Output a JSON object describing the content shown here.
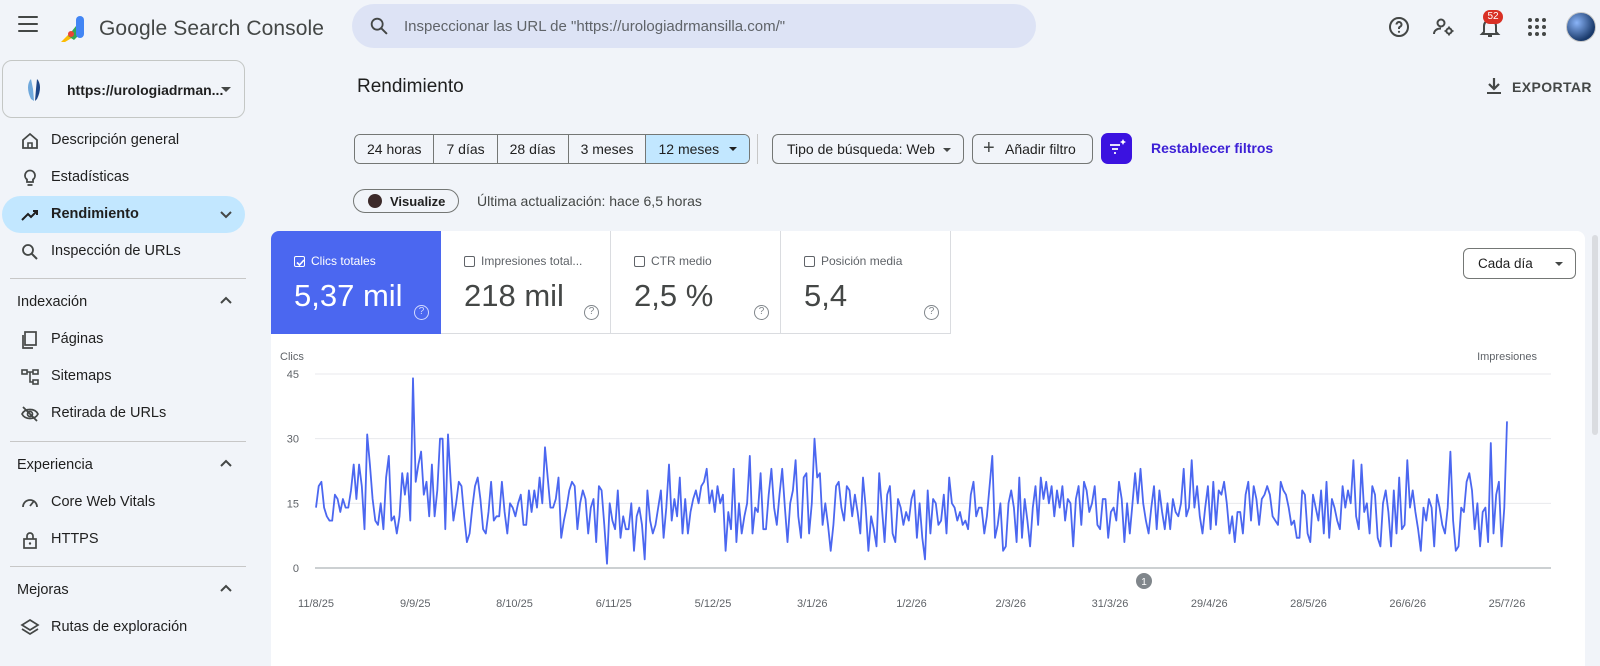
{
  "app": {
    "title": "Google Search Console"
  },
  "search": {
    "placeholder": "Inspeccionar las URL de \"https://urologiadrmansilla.com/\""
  },
  "notifications": {
    "count": "52"
  },
  "property": {
    "url": "https://urologiadrman..."
  },
  "sidebar": {
    "top_items": [
      {
        "label": "Descripción general",
        "icon": "home-icon"
      },
      {
        "label": "Estadísticas",
        "icon": "lightbulb-icon"
      },
      {
        "label": "Rendimiento",
        "icon": "trending-up-icon",
        "active": true
      },
      {
        "label": "Inspección de URLs",
        "icon": "search-icon"
      }
    ],
    "indexacion": {
      "title": "Indexación",
      "items": [
        {
          "label": "Páginas",
          "icon": "pages-icon"
        },
        {
          "label": "Sitemaps",
          "icon": "sitemap-icon"
        },
        {
          "label": "Retirada de URLs",
          "icon": "visibility-off-icon"
        }
      ]
    },
    "experiencia": {
      "title": "Experiencia",
      "items": [
        {
          "label": "Core Web Vitals",
          "icon": "speed-icon"
        },
        {
          "label": "HTTPS",
          "icon": "lock-icon"
        }
      ]
    },
    "mejoras": {
      "title": "Mejoras",
      "items": [
        {
          "label": "Rutas de exploración",
          "icon": "layers-icon"
        }
      ]
    }
  },
  "main": {
    "title": "Rendimiento",
    "export_label": "EXPORTAR",
    "ranges": [
      "24 horas",
      "7 días",
      "28 días",
      "3 meses",
      "12 meses"
    ],
    "selected_range": "12 meses",
    "search_type": "Tipo de búsqueda: Web",
    "add_filter": "Añadir filtro",
    "reset_filters": "Restablecer filtros",
    "visualize": "Visualize",
    "last_update": "Última actualización: hace 6,5 horas",
    "granularity": "Cada día"
  },
  "metrics": [
    {
      "label": "Clics totales",
      "value": "5,37 mil",
      "checked": true,
      "color": "#4b67f0"
    },
    {
      "label": "Impresiones total...",
      "value": "218 mil",
      "checked": false
    },
    {
      "label": "CTR medio",
      "value": "2,5 %",
      "checked": false
    },
    {
      "label": "Posición media",
      "value": "5,4",
      "checked": false
    }
  ],
  "chart_data": {
    "type": "line",
    "ylabel_left": "Clics",
    "ylabel_right": "Impresiones",
    "ylim": [
      0,
      45
    ],
    "yticks": [
      0,
      15,
      30,
      45
    ],
    "xtick_labels": [
      "11/8/25",
      "9/9/25",
      "8/10/25",
      "6/11/25",
      "5/12/25",
      "3/1/26",
      "1/2/26",
      "2/3/26",
      "31/3/26",
      "29/4/26",
      "28/5/26",
      "26/6/26",
      "25/7/26"
    ],
    "annotation": "1",
    "series": [
      {
        "color": "#4b67f0",
        "values": [
          14,
          19,
          20,
          14,
          12,
          11,
          11,
          17,
          16,
          13,
          16,
          14,
          14,
          18,
          24,
          16,
          24,
          19,
          9,
          31,
          24,
          16,
          11,
          10,
          15,
          9,
          21,
          26,
          11,
          12,
          8,
          12,
          22,
          17,
          22,
          11,
          44,
          20,
          24,
          27,
          17,
          20,
          12,
          24,
          12,
          18,
          30,
          30,
          9,
          31,
          20,
          11,
          15,
          20,
          19,
          12,
          6,
          8,
          14,
          19,
          21,
          16,
          9,
          8,
          13,
          20,
          11,
          12,
          12,
          20,
          13,
          8,
          15,
          14,
          12,
          15,
          17,
          10,
          10,
          18,
          13,
          18,
          14,
          21,
          15,
          28,
          21,
          14,
          14,
          16,
          21,
          7,
          11,
          14,
          18,
          20,
          19,
          9,
          15,
          18,
          16,
          8,
          14,
          16,
          6,
          19,
          18,
          10,
          1,
          15,
          11,
          9,
          18,
          7,
          12,
          9,
          9,
          15,
          4,
          12,
          14,
          10,
          2,
          18,
          11,
          8,
          10,
          14,
          18,
          7,
          14,
          24,
          11,
          16,
          12,
          21,
          8,
          16,
          8,
          13,
          16,
          18,
          15,
          19,
          20,
          23,
          15,
          18,
          13,
          19,
          15,
          17,
          4,
          13,
          9,
          23,
          6,
          15,
          8,
          12,
          15,
          26,
          8,
          14,
          13,
          22,
          9,
          9,
          17,
          23,
          14,
          10,
          17,
          23,
          14,
          6,
          15,
          18,
          25,
          12,
          7,
          21,
          22,
          8,
          15,
          30,
          21,
          22,
          10,
          15,
          10,
          4,
          10,
          19,
          20,
          14,
          11,
          19,
          18,
          12,
          17,
          13,
          8,
          21,
          14,
          4,
          12,
          9,
          5,
          22,
          14,
          6,
          17,
          19,
          8,
          6,
          16,
          14,
          10,
          13,
          11,
          16,
          18,
          7,
          15,
          7,
          2,
          18,
          8,
          16,
          15,
          10,
          11,
          17,
          8,
          21,
          15,
          14,
          11,
          13,
          10,
          11,
          9,
          17,
          20,
          12,
          14,
          14,
          8,
          12,
          19,
          26,
          7,
          10,
          15,
          4,
          5,
          15,
          18,
          14,
          6,
          21,
          7,
          16,
          11,
          5,
          14,
          19,
          10,
          21,
          16,
          20,
          15,
          19,
          12,
          18,
          14,
          19,
          11,
          16,
          15,
          5,
          16,
          19,
          10,
          20,
          18,
          13,
          15,
          19,
          10,
          9,
          16,
          16,
          7,
          13,
          14,
          11,
          20,
          16,
          6,
          15,
          8,
          15,
          22,
          15,
          23,
          15,
          11,
          8,
          14,
          19,
          9,
          18,
          13,
          9,
          15,
          9,
          16,
          13,
          12,
          15,
          23,
          12,
          14,
          25,
          14,
          19,
          12,
          8,
          14,
          19,
          9,
          20,
          10,
          18,
          17,
          20,
          15,
          8,
          12,
          6,
          13,
          13,
          8,
          17,
          20,
          11,
          19,
          16,
          10,
          16,
          17,
          19,
          17,
          12,
          11,
          10,
          20,
          18,
          17,
          14,
          10,
          11,
          7,
          7,
          18,
          17,
          8,
          6,
          17,
          14,
          11,
          18,
          8,
          20,
          7,
          16,
          14,
          11,
          9,
          19,
          14,
          18,
          15,
          25,
          12,
          9,
          24,
          13,
          15,
          8,
          19,
          17,
          7,
          5,
          15,
          18,
          13,
          5,
          18,
          8,
          21,
          9,
          10,
          25,
          14,
          18,
          13,
          9,
          4,
          14,
          11,
          16,
          14,
          5,
          17,
          14,
          10,
          8,
          14,
          27,
          11,
          4,
          5,
          14,
          13,
          20,
          22,
          18,
          9,
          15,
          5,
          13,
          14,
          6,
          29,
          8,
          17,
          20,
          5,
          14,
          34
        ]
      }
    ]
  }
}
